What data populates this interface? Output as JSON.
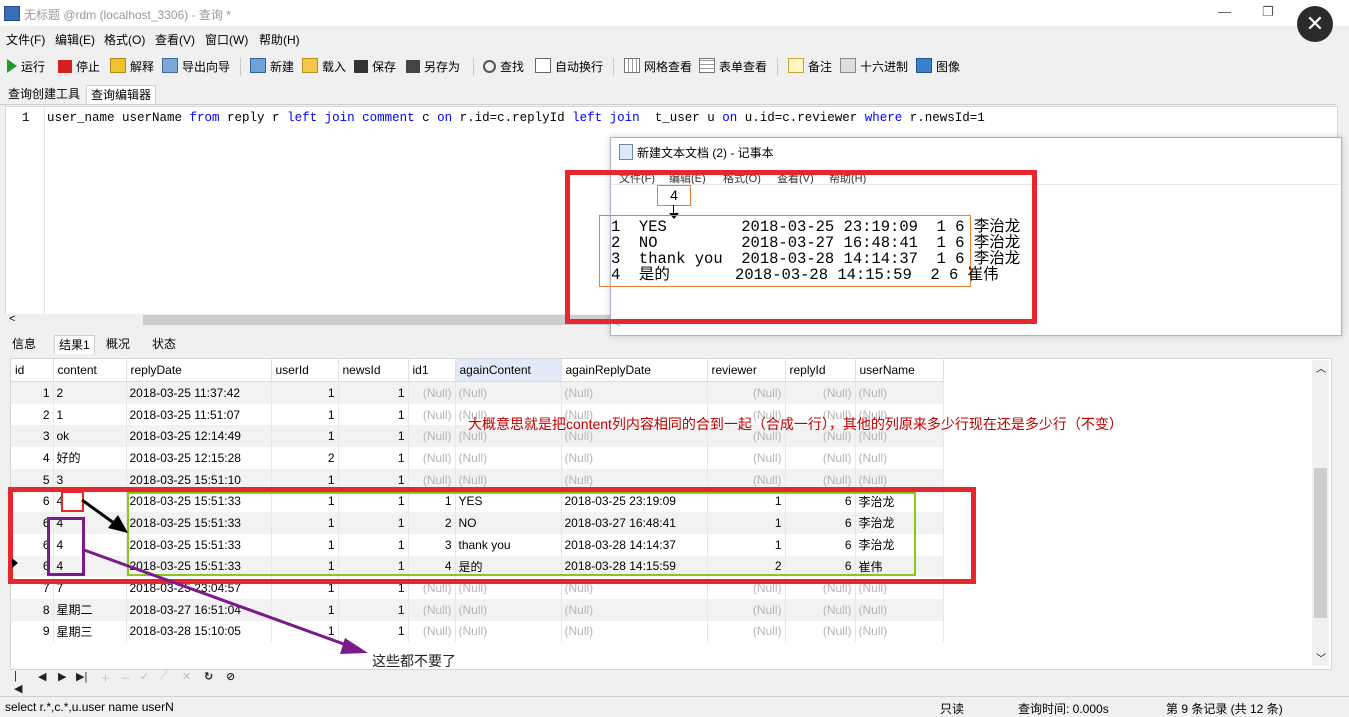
{
  "window": {
    "title": "无标题 @rdm (localhost_3306) - 查询 *",
    "minimize": "—",
    "restore": "❐",
    "close": "✕"
  },
  "menu": [
    "文件(F)",
    "编辑(E)",
    "格式(O)",
    "查看(V)",
    "窗口(W)",
    "帮助(H)"
  ],
  "toolbar": {
    "run": "运行",
    "stop": "停止",
    "explain": "解释",
    "export_wizard": "导出向导",
    "new": "新建",
    "load": "载入",
    "save": "保存",
    "save_as": "另存为",
    "find": "查找",
    "word_wrap": "自动换行",
    "grid_view": "网格查看",
    "form_view": "表单查看",
    "memo": "备注",
    "hex": "十六进制",
    "image": "图像"
  },
  "query_tabs": {
    "builder": "查询创建工具",
    "editor": "查询编辑器"
  },
  "editor": {
    "line_number": "1",
    "sql": [
      {
        "t": "user_name userName ",
        "k": false
      },
      {
        "t": "from",
        "k": true
      },
      {
        "t": " reply r ",
        "k": false
      },
      {
        "t": "left join",
        "k": true
      },
      {
        "t": " ",
        "k": false
      },
      {
        "t": "comment",
        "k": true
      },
      {
        "t": " c ",
        "k": false
      },
      {
        "t": "on",
        "k": true
      },
      {
        "t": " r.id=c.replyId ",
        "k": false
      },
      {
        "t": "left join",
        "k": true
      },
      {
        "t": "  t_user u ",
        "k": false
      },
      {
        "t": "on",
        "k": true
      },
      {
        "t": " u.id=c.reviewer ",
        "k": false
      },
      {
        "t": "where",
        "k": true
      },
      {
        "t": " r.newsId=1",
        "k": false
      }
    ]
  },
  "result_tabs": {
    "info": "信息",
    "result1": "结果1",
    "profile": "概况",
    "status": "状态"
  },
  "grid": {
    "columns": [
      "id",
      "content",
      "replyDate",
      "userId",
      "newsId",
      "id1",
      "againContent",
      "againReplyDate",
      "reviewer",
      "replyId",
      "userName"
    ],
    "rows": [
      [
        "1",
        "2",
        "2018-03-25 11:37:42",
        "1",
        "1",
        "(Null)",
        "(Null)",
        "(Null)",
        "(Null)",
        "(Null)",
        "(Null)"
      ],
      [
        "2",
        "1",
        "2018-03-25 11:51:07",
        "1",
        "1",
        "(Null)",
        "(Null)",
        "(Null)",
        "(Null)",
        "(Null)",
        "(Null)"
      ],
      [
        "3",
        "ok",
        "2018-03-25 12:14:49",
        "1",
        "1",
        "(Null)",
        "(Null)",
        "(Null)",
        "(Null)",
        "(Null)",
        "(Null)"
      ],
      [
        "4",
        "好的",
        "2018-03-25 12:15:28",
        "2",
        "1",
        "(Null)",
        "(Null)",
        "(Null)",
        "(Null)",
        "(Null)",
        "(Null)"
      ],
      [
        "5",
        "3",
        "2018-03-25 15:51:10",
        "1",
        "1",
        "(Null)",
        "(Null)",
        "(Null)",
        "(Null)",
        "(Null)",
        "(Null)"
      ],
      [
        "6",
        "4",
        "2018-03-25 15:51:33",
        "1",
        "1",
        "1",
        "YES",
        "2018-03-25 23:19:09",
        "1",
        "6",
        "李治龙"
      ],
      [
        "6",
        "4",
        "2018-03-25 15:51:33",
        "1",
        "1",
        "2",
        "NO",
        "2018-03-27 16:48:41",
        "1",
        "6",
        "李治龙"
      ],
      [
        "6",
        "4",
        "2018-03-25 15:51:33",
        "1",
        "1",
        "3",
        "thank you",
        "2018-03-28 14:14:37",
        "1",
        "6",
        "李治龙"
      ],
      [
        "6",
        "4",
        "2018-03-25 15:51:33",
        "1",
        "1",
        "4",
        "是的",
        "2018-03-28 14:15:59",
        "2",
        "6",
        "崔伟"
      ],
      [
        "7",
        "7",
        "2018-03-25 23:04:57",
        "1",
        "1",
        "(Null)",
        "(Null)",
        "(Null)",
        "(Null)",
        "(Null)",
        "(Null)"
      ],
      [
        "8",
        "星期二",
        "2018-03-27 16:51:04",
        "1",
        "1",
        "(Null)",
        "(Null)",
        "(Null)",
        "(Null)",
        "(Null)",
        "(Null)"
      ],
      [
        "9",
        "星期三",
        "2018-03-28 15:10:05",
        "1",
        "1",
        "(Null)",
        "(Null)",
        "(Null)",
        "(Null)",
        "(Null)",
        "(Null)"
      ]
    ]
  },
  "notepad": {
    "title": "新建文本文档 (2) - 记事本",
    "menu": [
      "文件(F)",
      "编辑(E)",
      "格式(O)",
      "查看(V)",
      "帮助(H)"
    ],
    "box_value": "4",
    "lines": [
      "1  YES        2018-03-25 23:19:09  1 6 李治龙",
      "2  NO         2018-03-27 16:48:41  1 6 李治龙",
      "3  thank you  2018-03-28 14:14:37  1 6 李治龙",
      "4  是的       2018-03-28 14:15:59  2 6 崔伟"
    ]
  },
  "annotations": {
    "main_note": "大概意思就是把content列内容相同的合到一起（合成一行），其他的列原来多少行现在还是多少行（不变）",
    "discard_note": "这些都不要了"
  },
  "status": {
    "sql": "select r.*,c.*,u.user name userN",
    "readonly": "只读",
    "query_time": "查询时间: 0.000s",
    "records": "第 9 条记录 (共 12 条)"
  },
  "colors": {
    "annotation_red": "#e8262d",
    "annotation_green": "#8fc31f",
    "annotation_purple": "#7b1a8a",
    "keyword_blue": "#0000ff"
  }
}
